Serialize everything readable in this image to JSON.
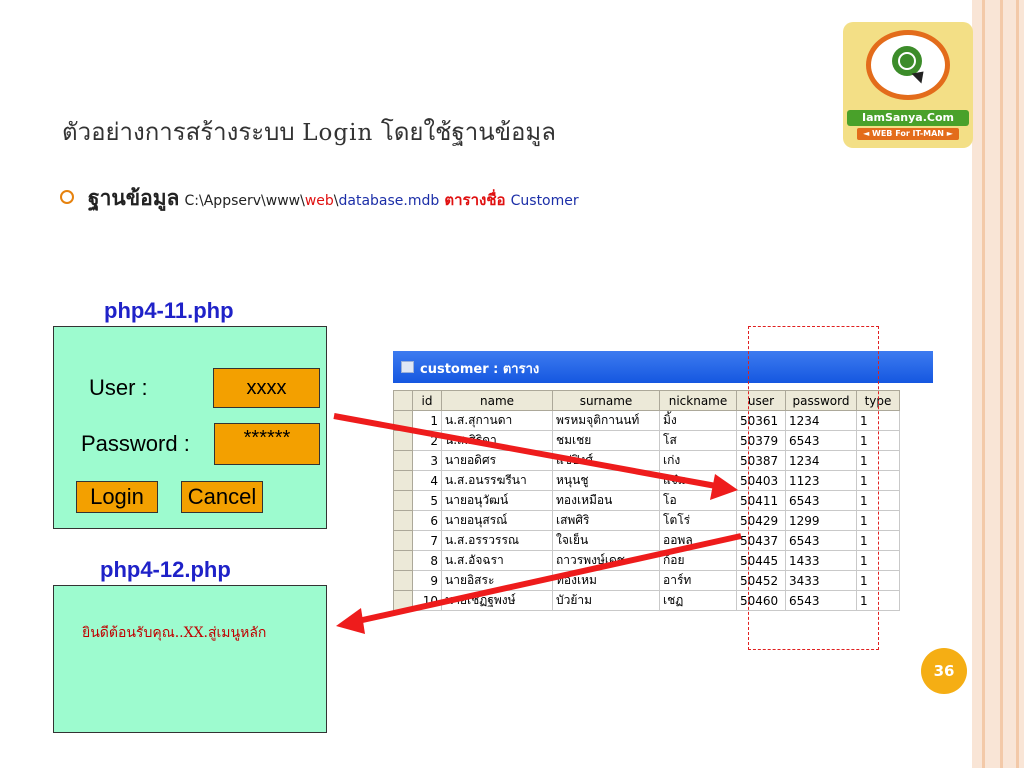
{
  "slide": {
    "title_thai": "ตัวอย่างการสร้างระบบ",
    "title_login": "Login",
    "title_tail": "โดยใช้ฐานข้อมูล",
    "bullet": {
      "thai": "ฐานข้อมูล",
      "path": "C:\\Appserv\\www\\",
      "web": "web",
      "sep": "\\",
      "db": "database.mdb",
      "table_word": "ตารางชื่อ",
      "table_name": "Customer"
    },
    "page_number": "36"
  },
  "logo": {
    "name": "IamSanya.Com",
    "tag": "◄ WEB For IT-MAN ►"
  },
  "login_page": {
    "title": "php4-11.php",
    "user_label": "User :",
    "user_value": "xxxx",
    "password_label": "Password :",
    "password_value": "******",
    "login_button": "Login",
    "cancel_button": "Cancel"
  },
  "welcome_page": {
    "title": "php4-12.php",
    "message": "ยินดีต้อนรับคุณ..XX.สู่เมนูหลัก"
  },
  "db_window": {
    "title": "customer : ตาราง",
    "columns": [
      "id",
      "name",
      "surname",
      "nickname",
      "user",
      "password",
      "type"
    ],
    "rows": [
      [
        "1",
        "น.ส.สุกานดา",
        "พรหมจุติกานนท์",
        "มิ้ง",
        "50361",
        "1234",
        "1"
      ],
      [
        "2",
        "น.ส.ศิริดา",
        "ชมเชย",
        "โส",
        "50379",
        "6543",
        "1"
      ],
      [
        "3",
        "นายอดิศร",
        "แซ่ปิงศ์",
        "เก่ง",
        "50387",
        "1234",
        "1"
      ],
      [
        "4",
        "น.ส.อนรรฆรีนา",
        "หนุนชู",
        "แจ๋ม",
        "50403",
        "1123",
        "1"
      ],
      [
        "5",
        "นายอนุวัฒน์",
        "ทองเหมือน",
        "โอ",
        "50411",
        "6543",
        "1"
      ],
      [
        "6",
        "นายอนุสรณ์",
        "เสพศิริ",
        "โตโร่",
        "50429",
        "1299",
        "1"
      ],
      [
        "7",
        "น.ส.อรรวรรณ",
        "ใจเย็น",
        "ออพล",
        "50437",
        "6543",
        "1"
      ],
      [
        "8",
        "น.ส.อัจฉรา",
        "ถาวรพงษ์เดช",
        "ก้อย",
        "50445",
        "1433",
        "1"
      ],
      [
        "9",
        "นายอิสระ",
        "ทองเหม",
        "อาร์ท",
        "50452",
        "3433",
        "1"
      ],
      [
        "10",
        "นายเชฏฐพงษ์",
        "บัวย้าม",
        "เชฏ",
        "50460",
        "6543",
        "1"
      ]
    ]
  },
  "colors": {
    "accent_orange": "#e6820e",
    "panel_green": "#9dfbcf",
    "field_orange": "#f3a000",
    "arrow_red": "#ee1c1c",
    "label_blue": "#1f22c8"
  }
}
